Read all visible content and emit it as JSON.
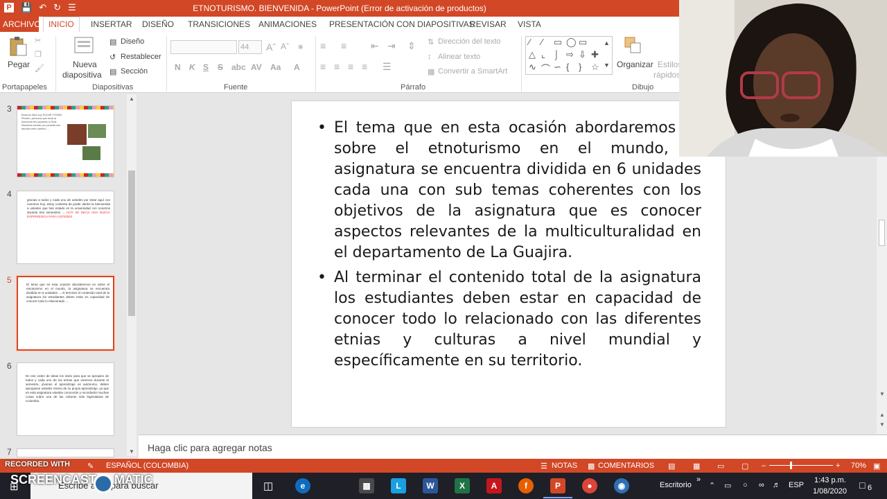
{
  "window": {
    "title": "ETNOTURISMO. BIENVENIDA -  PowerPoint (Error de activación de productos)"
  },
  "tabs": [
    {
      "label": "ARCHIVO"
    },
    {
      "label": "INICIO"
    },
    {
      "label": "INSERTAR"
    },
    {
      "label": "DISEÑO"
    },
    {
      "label": "TRANSICIONES"
    },
    {
      "label": "ANIMACIONES"
    },
    {
      "label": "PRESENTACIÓN CON DIAPOSITIVAS"
    },
    {
      "label": "REVISAR"
    },
    {
      "label": "VISTA"
    }
  ],
  "ribbon": {
    "paste": "Pegar",
    "new_slide": [
      "Nueva",
      "diapositiva"
    ],
    "layout": "Diseño",
    "reset": "Restablecer",
    "section": "Sección",
    "font_size": "44",
    "text_direction": "Dirección del texto",
    "align_text": "Alinear texto",
    "smartart": "Convertir a SmartArt",
    "arrange": "Organizar",
    "quick_styles": [
      "Estilos",
      "rápidos"
    ],
    "groups": [
      "Portapapeles",
      "Diapositivas",
      "Fuente",
      "Párrafo",
      "Dibujo"
    ]
  },
  "thumbnails": [
    {
      "num": "3",
      "text": "Buenos días soy SOLMI YOVAN Pinedo, persona que toda la docencia les gozaras a Ocar. Nosotros beban por permitirnos asociar este camino ..."
    },
    {
      "num": "4",
      "text": "gracias a todos y cada uno de ustedes por estar aquí con nosotros hoy, estoy contenta de poder darles la bienvenida a ustedes que han estado en la universidad con nosotros durante tres semestres ...",
      "highlight": "HOY SE INICIA UNA NUEVA EXPERIENCIA PARA USTEDES"
    },
    {
      "num": "5",
      "text": "El tema que en esta ocasión abordaremos es sobre el etnoturismo en el mundo, la asignatura se encuentra dividida en 6 unidades ... Al terminar el contenido total de la asignatura los estudiantes deben estar en capacidad de conocer todo lo relacionado ..."
    },
    {
      "num": "6",
      "text": "En ese orden de ideas los invito para que se apropien de todos y cada uno de los temas que veremos durante el semestre, jóvenes el aprendizaje es autónomo, deben apropiarse ustedes mismo de su propio aprendizaje, ya que en esta asignatura ustedes conocerán y recordarán muchas cosas sobre una de las culturas más legendarias de Colombia."
    },
    {
      "num": "7",
      "text": ""
    }
  ],
  "slide": {
    "bullets": [
      "El tema que en esta ocasión abordaremos es sobre el etnoturismo en el mundo, la asignatura se encuentra dividida en 6 unidades cada una con sub temas coherentes con los objetivos de la asignatura que es conocer aspectos relevantes de la multiculturalidad en el departamento de La Guajira.",
      "Al terminar el contenido total de la asignatura los estudiantes deben estar en capacidad de conocer todo lo relacionado con las diferentes etnias y culturas a nivel mundial y específicamente en su territorio."
    ]
  },
  "notes": {
    "placeholder": "Haga clic para agregar notas"
  },
  "statusbar": {
    "language": "ESPAÑOL (COLOMBIA)",
    "notes": "NOTAS",
    "comments": "COMENTARIOS",
    "zoom": "70%"
  },
  "watermark": {
    "line1": "RECORDED WITH",
    "line2": "SCREENCAST",
    "line3": "MATIC"
  },
  "taskbar": {
    "search_placeholder": "Escribe aquí para buscar",
    "desktop_label": "Escritorio",
    "lang": "ESP",
    "time": "1:43 p.m.",
    "date": "1/08/2020",
    "notifications": "6"
  },
  "colors": {
    "accent": "#d24726",
    "taskbar": "#1f1f28"
  }
}
